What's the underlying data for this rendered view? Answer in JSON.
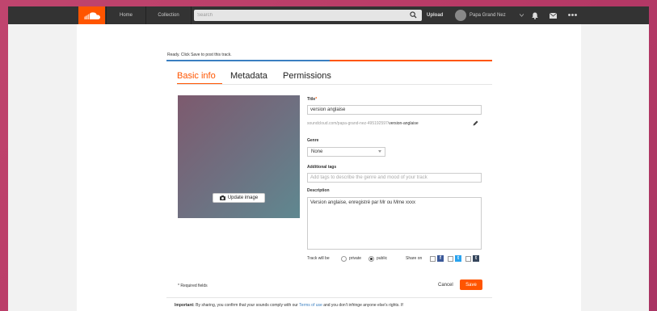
{
  "topbar": {
    "nav": {
      "home": "Home",
      "collection": "Collection"
    },
    "search_placeholder": "Search",
    "upload": "Upload",
    "user_name": "Papa Grand Nez"
  },
  "upload": {
    "status": "Ready. Click Save to post this track.",
    "progress": 0.5,
    "tabs": [
      "Basic info",
      "Metadata",
      "Permissions"
    ],
    "active_tab": "Basic info",
    "update_image_label": "Update image"
  },
  "form": {
    "title_label": "Title",
    "title_value": "version anglaise",
    "permalink_base": "soundcloud.com/papa-grand-nez-495192597/",
    "permalink_slug": "version-anglaise",
    "genre_label": "Genre",
    "genre_value": "None",
    "tags_label": "Additional tags",
    "tags_placeholder": "Add tags to describe the genre and mood of your track",
    "description_label": "Description",
    "description_value": "Version anglaise, enregistré par Mr ou Mme xxxx",
    "privacy_label": "Track will be",
    "privacy_options": [
      "private",
      "public"
    ],
    "privacy_selected": "public",
    "share_label": "Share on"
  },
  "footer": {
    "required_note": "* Required fields",
    "cancel": "Cancel",
    "save": "Save",
    "important_label": "Important:",
    "important_text": "By sharing, you confirm that your sounds comply with our",
    "terms_link": "Terms of use",
    "important_text_2": "and you don't infringe anyone else's rights. If"
  },
  "colors": {
    "accent": "#ff5500",
    "topbar": "#333333",
    "background": "#b83a66",
    "progress_done": "#3a7fc1"
  }
}
